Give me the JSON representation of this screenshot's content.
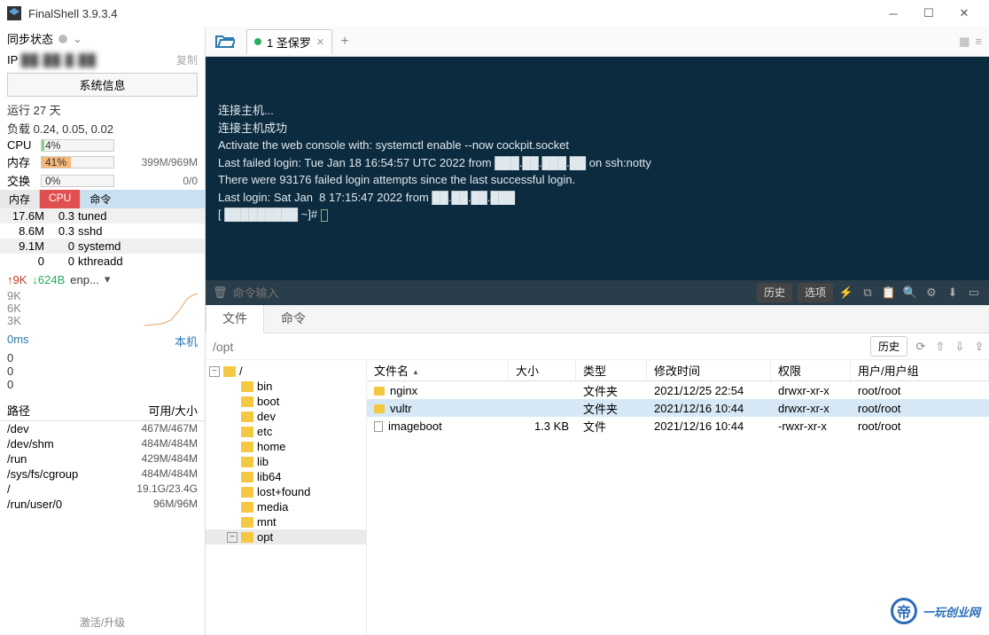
{
  "window": {
    "title": "FinalShell 3.9.3.4"
  },
  "sidebar": {
    "sync_label": "同步状态",
    "ip_label": "IP",
    "ip_blur": "██.██.█.██",
    "copy": "复制",
    "sysinfo_btn": "系统信息",
    "uptime": "运行 27 天",
    "load": "负载 0.24, 0.05, 0.02",
    "cpu_lbl": "CPU",
    "cpu_pct": "4%",
    "mem_lbl": "内存",
    "mem_pct": "41%",
    "mem_text": "399M/969M",
    "swap_lbl": "交换",
    "swap_pct": "0%",
    "swap_text": "0/0",
    "proc_tabs": [
      "内存",
      "CPU",
      "命令"
    ],
    "processes": [
      {
        "mem": "17.6M",
        "cpu": "0.3",
        "cmd": "tuned"
      },
      {
        "mem": "8.6M",
        "cpu": "0.3",
        "cmd": "sshd"
      },
      {
        "mem": "9.1M",
        "cpu": "0",
        "cmd": "systemd"
      },
      {
        "mem": "0",
        "cpu": "0",
        "cmd": "kthreadd"
      }
    ],
    "net_up": "↑9K",
    "net_down": "↓624B",
    "net_if": "enp...",
    "chart_ticks": [
      "9K",
      "6K",
      "3K"
    ],
    "ping": "0ms",
    "host_label": "本机",
    "zeros": [
      "0",
      "0",
      "0"
    ],
    "disk_headers": [
      "路径",
      "可用/大小"
    ],
    "disks": [
      {
        "path": "/dev",
        "size": "467M/467M"
      },
      {
        "path": "/dev/shm",
        "size": "484M/484M"
      },
      {
        "path": "/run",
        "size": "429M/484M"
      },
      {
        "path": "/sys/fs/cgroup",
        "size": "484M/484M"
      },
      {
        "path": "/",
        "size": "19.1G/23.4G"
      },
      {
        "path": "/run/user/0",
        "size": "96M/96M"
      }
    ],
    "foot": "激活/升级"
  },
  "tabs": {
    "active_label": "1 圣保罗"
  },
  "terminal": {
    "lines": [
      "连接主机...",
      "连接主机成功",
      "Activate the web console with: systemctl enable --now cockpit.socket",
      "",
      "Last failed login: Tue Jan 18 16:54:57 UTC 2022 from ███.██.███.██ on ssh:notty",
      "There were 93176 failed login attempts since the last successful login.",
      "Last login: Sat Jan  8 17:15:47 2022 from ██.██.██.███",
      "[ █████████ ~]# "
    ],
    "cmd_placeholder": "命令输入",
    "history_btn": "历史",
    "options_btn": "选项"
  },
  "bottom": {
    "tab_files": "文件",
    "tab_cmds": "命令",
    "path": "/opt",
    "history": "历史",
    "tree": [
      "/",
      "bin",
      "boot",
      "dev",
      "etc",
      "home",
      "lib",
      "lib64",
      "lost+found",
      "media",
      "mnt",
      "opt"
    ],
    "headers": {
      "name": "文件名",
      "size": "大小",
      "type": "类型",
      "mod": "修改时间",
      "perm": "权限",
      "user": "用户/用户组"
    },
    "rows": [
      {
        "icon": "folder",
        "name": "nginx",
        "size": "",
        "type": "文件夹",
        "mod": "2021/12/25 22:54",
        "perm": "drwxr-xr-x",
        "user": "root/root"
      },
      {
        "icon": "folder",
        "name": "vultr",
        "size": "",
        "type": "文件夹",
        "mod": "2021/12/16 10:44",
        "perm": "drwxr-xr-x",
        "user": "root/root",
        "sel": true
      },
      {
        "icon": "file",
        "name": "imageboot",
        "size": "1.3 KB",
        "type": "文件",
        "mod": "2021/12/16 10:44",
        "perm": "-rwxr-xr-x",
        "user": "root/root"
      }
    ]
  },
  "watermark": {
    "icon": "帝",
    "text": "一玩创业网"
  }
}
